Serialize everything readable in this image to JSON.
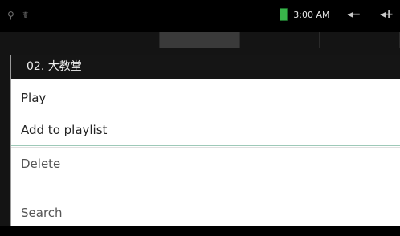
{
  "status_bar": {
    "icons": [
      "usb-icon",
      "usb-debug-icon"
    ],
    "time": "3:00 AM",
    "volume_down_label": "◂−",
    "volume_up_label": "◂+"
  },
  "dialog": {
    "title": "02. 大教堂",
    "items": [
      {
        "label": "Play"
      },
      {
        "label": "Add to playlist"
      },
      {
        "label": "Delete"
      },
      {
        "label": "Search"
      }
    ]
  },
  "colors": {
    "battery": "#39b54a",
    "dialog_title_bg": "#151515",
    "dialog_bg": "#ffffff"
  }
}
